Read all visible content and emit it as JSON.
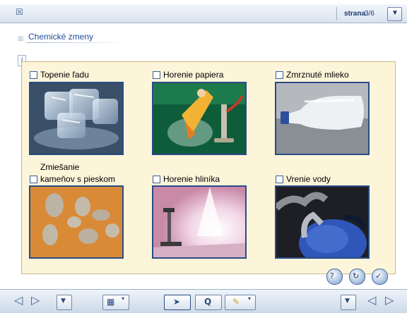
{
  "header": {
    "page_label": "strana",
    "page_number": "3/6"
  },
  "lesson": {
    "title": "Chemické zmeny"
  },
  "items": [
    {
      "label": "Topenie ľadu",
      "image": "ice-cubes-melting"
    },
    {
      "label": "Horenie papiera",
      "image": "paper-burning"
    },
    {
      "label": "Zmrznuté mlieko",
      "image": "frozen-milk-bottle"
    },
    {
      "label": "Zmiešanie kameňov s pieskom",
      "label_line1": "Zmiešanie",
      "label_line2": "kameňov s pieskom",
      "image": "stones-in-sand"
    },
    {
      "label": "Horenie hliníka",
      "image": "aluminium-burning"
    },
    {
      "label": "Vrenie vody",
      "image": "boiling-kettle"
    }
  ],
  "colors": {
    "accent": "#1e4a9a",
    "panel_bg": "#fdf5da",
    "photo_border": "#294b86"
  }
}
